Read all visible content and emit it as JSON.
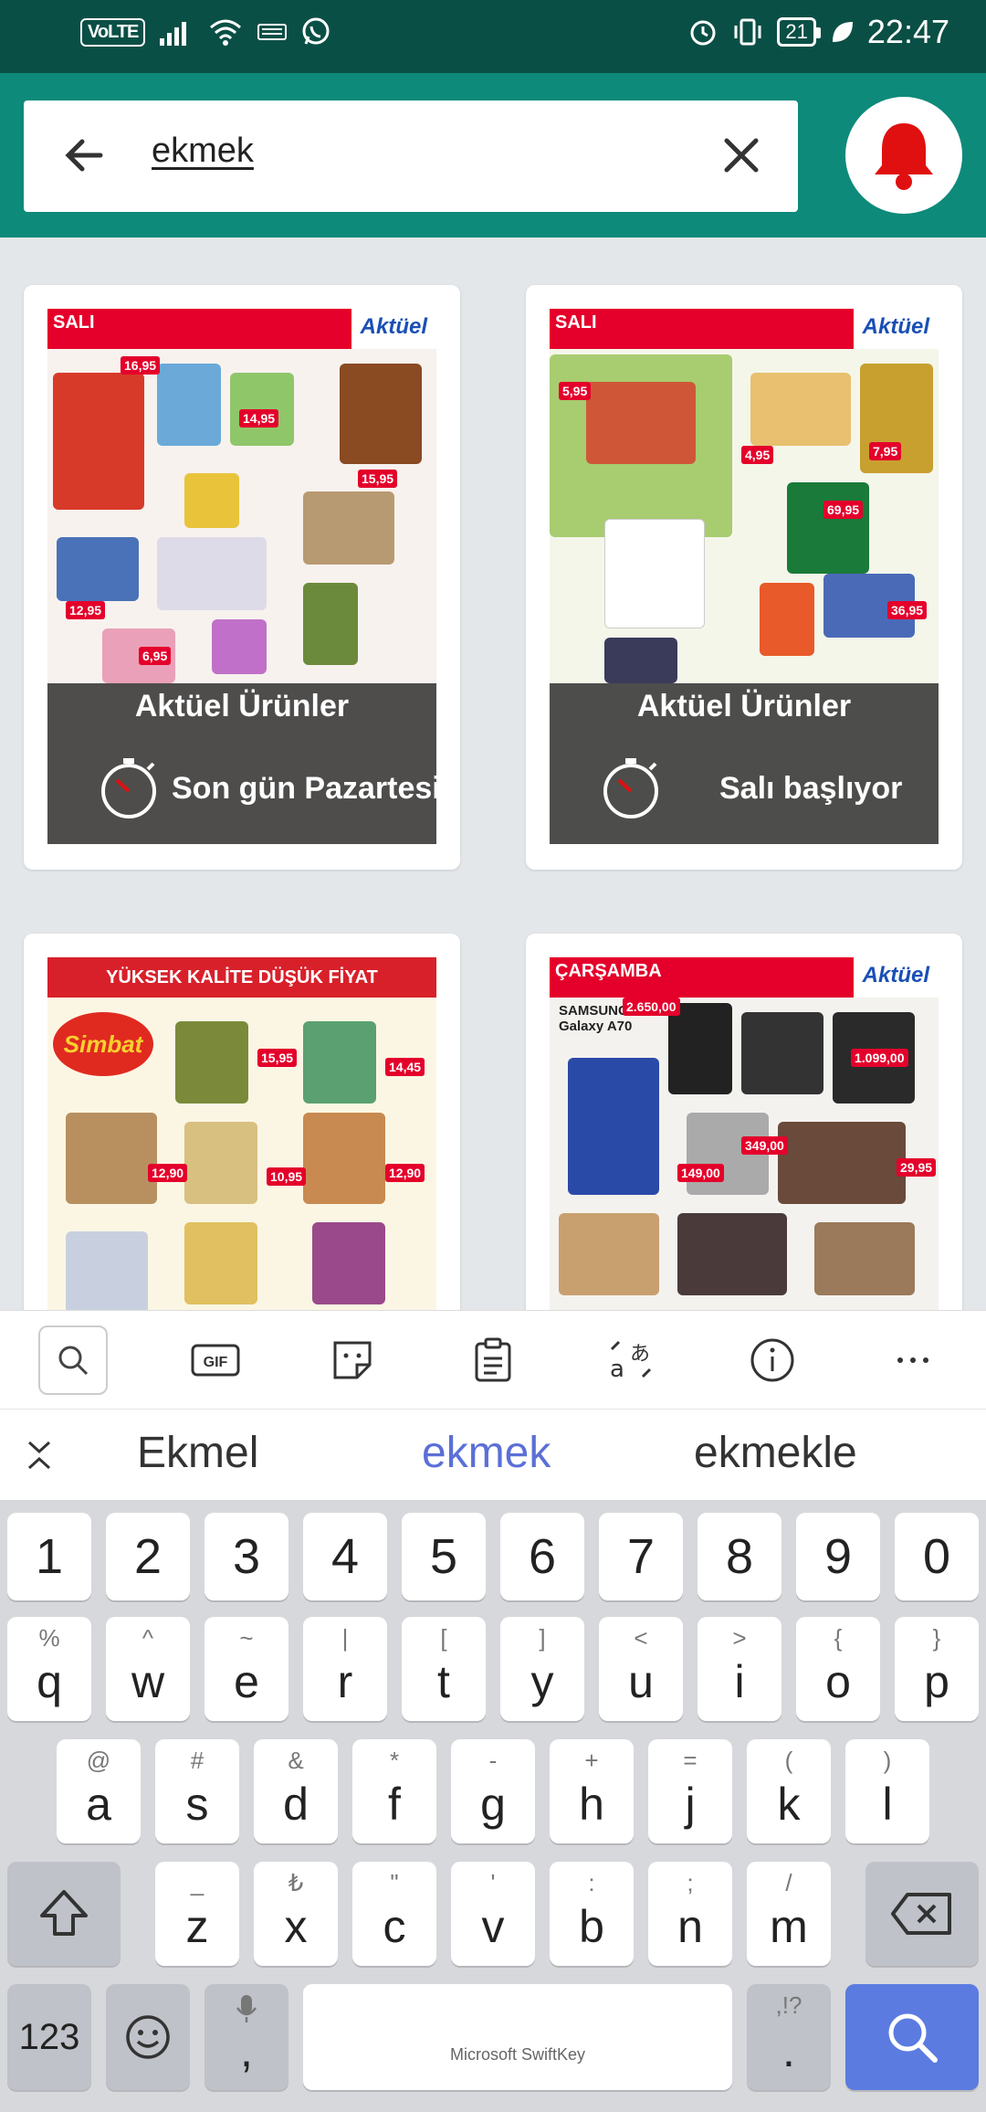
{
  "status_bar": {
    "volte": "VoLTE",
    "battery": "21",
    "time": "22:47"
  },
  "search": {
    "query": "ekmek"
  },
  "catalogs": [
    {
      "day": "SALI",
      "brand": "Aktüel",
      "title": "Aktüel Ürünler",
      "status": "Son gün Pazartesi"
    },
    {
      "day": "SALI",
      "brand": "Aktüel",
      "title": "Aktüel Ürünler",
      "status": "Salı başlıyor"
    },
    {
      "banner": "YÜKSEK KALİTE DÜŞÜK FİYAT",
      "brand": "Simbat"
    },
    {
      "day": "ÇARŞAMBA",
      "brand": "Aktüel",
      "product": "SAMSUNG Galaxy A70"
    }
  ],
  "keyboard": {
    "suggestions": [
      "Ekmel",
      "ekmek",
      "ekmekle"
    ],
    "number_row": [
      "1",
      "2",
      "3",
      "4",
      "5",
      "6",
      "7",
      "8",
      "9",
      "0"
    ],
    "row1": [
      {
        "k": "q",
        "alt": "%"
      },
      {
        "k": "w",
        "alt": "^"
      },
      {
        "k": "e",
        "alt": "~"
      },
      {
        "k": "r",
        "alt": "|"
      },
      {
        "k": "t",
        "alt": "["
      },
      {
        "k": "y",
        "alt": "]"
      },
      {
        "k": "u",
        "alt": "<"
      },
      {
        "k": "i",
        "alt": ">"
      },
      {
        "k": "o",
        "alt": "{"
      },
      {
        "k": "p",
        "alt": "}"
      }
    ],
    "row2": [
      {
        "k": "a",
        "alt": "@"
      },
      {
        "k": "s",
        "alt": "#"
      },
      {
        "k": "d",
        "alt": "&"
      },
      {
        "k": "f",
        "alt": "*"
      },
      {
        "k": "g",
        "alt": "-"
      },
      {
        "k": "h",
        "alt": "+"
      },
      {
        "k": "j",
        "alt": "="
      },
      {
        "k": "k",
        "alt": "("
      },
      {
        "k": "l",
        "alt": ")"
      }
    ],
    "row3": [
      {
        "k": "z",
        "alt": "_"
      },
      {
        "k": "x",
        "alt": "₺"
      },
      {
        "k": "c",
        "alt": "\""
      },
      {
        "k": "v",
        "alt": "'"
      },
      {
        "k": "b",
        "alt": ":"
      },
      {
        "k": "n",
        "alt": ";"
      },
      {
        "k": "m",
        "alt": "/"
      }
    ],
    "mode_key": "123",
    "comma": ",",
    "space_label": "Microsoft SwiftKey",
    "period": ".",
    "period_alt": ",!?"
  },
  "colors": {
    "status_bar": "#0a4f45",
    "app_bar": "#0d8a7a",
    "bell": "#e01010",
    "suggest_highlight": "#5b6fd6",
    "enter_key": "#5b7be0"
  }
}
